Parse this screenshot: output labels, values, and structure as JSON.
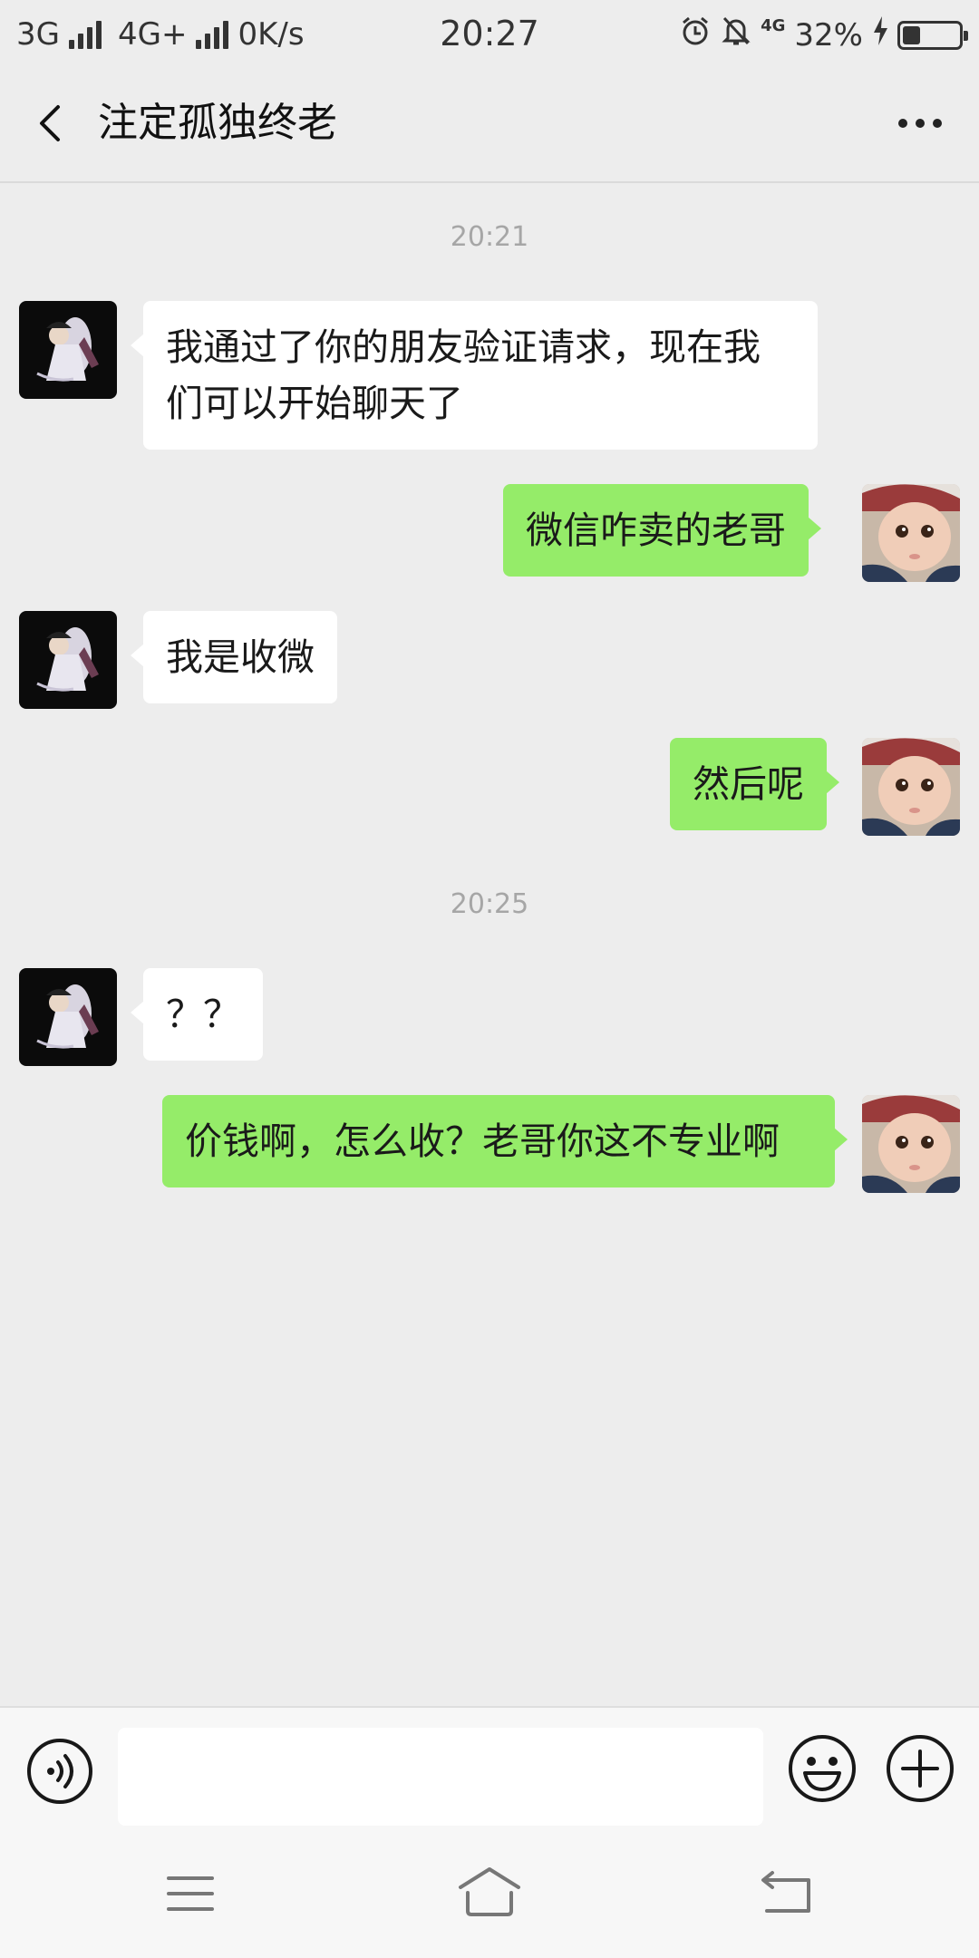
{
  "status_bar": {
    "net1": "3G",
    "net2": "4G+",
    "speed": "0K/s",
    "time": "20:27",
    "small_4g": "4G",
    "battery_percent": "32%",
    "battery_level": 0.32
  },
  "header": {
    "title": "注定孤独终老"
  },
  "chat": {
    "timestamps": [
      "20:21",
      "20:25"
    ],
    "messages": [
      {
        "direction": "incoming",
        "text": "我通过了你的朋友验证请求，现在我们可以开始聊天了"
      },
      {
        "direction": "outgoing",
        "text": "微信咋卖的老哥"
      },
      {
        "direction": "incoming",
        "text": "我是收微"
      },
      {
        "direction": "outgoing",
        "text": "然后呢"
      },
      {
        "direction": "incoming",
        "text": "？？"
      },
      {
        "direction": "outgoing",
        "text": "价钱啊，怎么收？老哥你这不专业啊"
      }
    ]
  },
  "input_bar": {
    "value": "",
    "placeholder": ""
  },
  "icons": {
    "back": "chevron-left-icon",
    "more": "more-dots-icon",
    "voice": "voice-icon",
    "emoji": "emoji-icon",
    "plus": "plus-icon",
    "nav_menu": "menu-icon",
    "nav_home": "home-icon",
    "nav_back": "return-icon"
  },
  "colors": {
    "background": "#ededed",
    "outgoing_bubble": "#95ec69",
    "incoming_bubble": "#ffffff",
    "timestamp": "#a6a6a6"
  }
}
